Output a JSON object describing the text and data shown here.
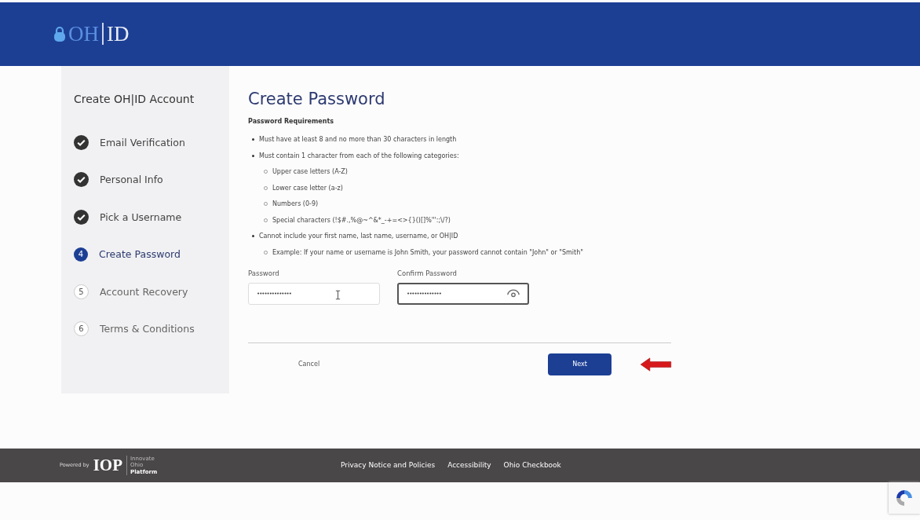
{
  "header": {
    "logo_left": "OH",
    "logo_right": "ID"
  },
  "sidebar": {
    "title": "Create OH|ID Account",
    "steps": [
      {
        "kind": "done",
        "label": "Email Verification"
      },
      {
        "kind": "done",
        "label": "Personal Info"
      },
      {
        "kind": "done",
        "label": "Pick a Username"
      },
      {
        "kind": "current",
        "number": "4",
        "label": "Create Password"
      },
      {
        "kind": "pending",
        "number": "5",
        "label": "Account Recovery"
      },
      {
        "kind": "pending",
        "number": "6",
        "label": "Terms & Conditions"
      }
    ]
  },
  "main": {
    "title": "Create Password",
    "requirements_heading": "Password Requirements",
    "requirements": [
      {
        "text": "Must have at least 8 and no more than 30 characters in length"
      },
      {
        "text": "Must contain 1 character from each of the following categories:",
        "children": [
          "Upper case letters (A-Z)",
          "Lower case letter (a-z)",
          "Numbers (0-9)",
          "Special characters (!$#.,%@~^&*_-+=<>{}()[]%\"':;\\/?)"
        ]
      },
      {
        "text": "Cannot include your first name, last name, username, or OH|ID",
        "children": [
          "Example: If your name or username is John Smith, your password cannot contain \"John\" or \"Smith\""
        ]
      }
    ],
    "fields": [
      {
        "label": "Password",
        "value": "••••••••••••••",
        "focused": false,
        "reveal_icon": false
      },
      {
        "label": "Confirm Password",
        "value": "••••••••••••••",
        "focused": true,
        "reveal_icon": true
      }
    ],
    "cancel": "Cancel",
    "next": "Next"
  },
  "footer": {
    "powered_by": "Powered by",
    "brand": "IOP",
    "brand_lines": [
      "Innovate",
      "Ohio",
      "Platform"
    ],
    "links": [
      "Privacy Notice and Policies",
      "Accessibility",
      "Ohio Checkbook"
    ]
  }
}
